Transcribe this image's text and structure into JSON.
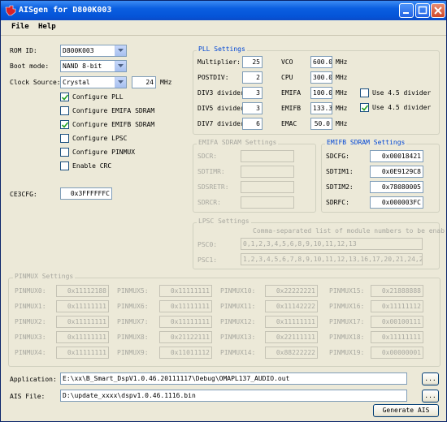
{
  "window": {
    "title": "AISgen for D800K003"
  },
  "menu": [
    "File",
    "Help"
  ],
  "left": {
    "rom_id_label": "ROM ID:",
    "rom_id_value": "D800K003",
    "boot_mode_label": "Boot mode:",
    "boot_mode_value": "NAND 8-bit",
    "clock_source_label": "Clock Source:",
    "clock_source_value": "Crystal",
    "clock_freq": "24",
    "clock_unit": "MHz",
    "checkboxes": [
      {
        "label": "Configure PLL",
        "checked": true
      },
      {
        "label": "Configure EMIFA SDRAM",
        "checked": false
      },
      {
        "label": "Configure EMIFB SDRAM",
        "checked": true
      },
      {
        "label": "Configure LPSC",
        "checked": false
      },
      {
        "label": "Configure PINMUX",
        "checked": false
      },
      {
        "label": "Enable CRC",
        "checked": false
      }
    ],
    "ce3cfg_label": "CE3CFG:",
    "ce3cfg_value": "0x3FFFFFFC"
  },
  "pll": {
    "title": "PLL Settings",
    "rows": [
      {
        "label": "Multiplier:",
        "value": "25",
        "clk": "VCO",
        "clk_value": "600.0",
        "unit": "MHz"
      },
      {
        "label": "POSTDIV:",
        "value": "2",
        "clk": "CPU",
        "clk_value": "300.0",
        "unit": "MHz"
      },
      {
        "label": "DIV3 divider:",
        "value": "3",
        "clk": "EMIFA",
        "clk_value": "100.0",
        "unit": "MHz"
      },
      {
        "label": "DIV5 divider:",
        "value": "3",
        "clk": "EMIFB",
        "clk_value": "133.3",
        "unit": "MHz"
      },
      {
        "label": "DIV7 divider:",
        "value": "6",
        "clk": "EMAC",
        "clk_value": "50.0",
        "unit": "MHz"
      }
    ],
    "use45_a": {
      "label": "Use 4.5 divider",
      "checked": false
    },
    "use45_b": {
      "label": "Use 4.5 divider",
      "checked": true
    }
  },
  "emifa": {
    "title": "EMIFA SDRAM Settings",
    "fields": [
      {
        "label": "SDCR:",
        "value": ""
      },
      {
        "label": "SDTIMR:",
        "value": ""
      },
      {
        "label": "SDSRETR:",
        "value": ""
      },
      {
        "label": "SDRCR:",
        "value": ""
      }
    ]
  },
  "emifb": {
    "title": "EMIFB SDRAM Settings",
    "fields": [
      {
        "label": "SDCFG:",
        "value": "0x00018421"
      },
      {
        "label": "SDTIM1:",
        "value": "0x0E9129C8"
      },
      {
        "label": "SDTIM2:",
        "value": "0x78080005"
      },
      {
        "label": "SDRFC:",
        "value": "0x000003FC"
      }
    ]
  },
  "lpsc": {
    "title": "LPSC Settings",
    "hint": "Comma-separated list of module numbers to be enab",
    "psc0_label": "PSC0:",
    "psc0_value": "0,1,2,3,4,5,6,8,9,10,11,12,13",
    "psc1_label": "PSC1:",
    "psc1_value": "1,2,3,4,5,6,7,8,9,10,11,12,13,16,17,20,21,24,25"
  },
  "pinmux": {
    "title": "PINMUX Settings",
    "cols": [
      [
        {
          "label": "PINMUX0:",
          "value": "0x11112188"
        },
        {
          "label": "PINMUX1:",
          "value": "0x11111111"
        },
        {
          "label": "PINMUX2:",
          "value": "0x11111111"
        },
        {
          "label": "PINMUX3:",
          "value": "0x11111111"
        },
        {
          "label": "PINMUX4:",
          "value": "0x11111111"
        }
      ],
      [
        {
          "label": "PINMUX5:",
          "value": "0x11111111"
        },
        {
          "label": "PINMUX6:",
          "value": "0x11111111"
        },
        {
          "label": "PINMUX7:",
          "value": "0x11111111"
        },
        {
          "label": "PINMUX8:",
          "value": "0x21122111"
        },
        {
          "label": "PINMUX9:",
          "value": "0x11011112"
        }
      ],
      [
        {
          "label": "PINMUX10:",
          "value": "0x22222221"
        },
        {
          "label": "PINMUX11:",
          "value": "0x11142222"
        },
        {
          "label": "PINMUX12:",
          "value": "0x11111111"
        },
        {
          "label": "PINMUX13:",
          "value": "0x22111111"
        },
        {
          "label": "PINMUX14:",
          "value": "0x88222222"
        }
      ],
      [
        {
          "label": "PINMUX15:",
          "value": "0x21888888"
        },
        {
          "label": "PINMUX16:",
          "value": "0x11111112"
        },
        {
          "label": "PINMUX17:",
          "value": "0x00100111"
        },
        {
          "label": "PINMUX18:",
          "value": "0x11111111"
        },
        {
          "label": "PINMUX19:",
          "value": "0x00000001"
        }
      ]
    ]
  },
  "files": {
    "application_label": "Application:",
    "application_value": "E:\\xx\\B_Smart_DspV1.0.46.20111117\\Debug\\OMAPL137_AUDIO.out",
    "ais_label": "AIS File:",
    "ais_value": "D:\\update_xxxx\\dspv1.0.46.1116.bin",
    "browse_label": "...",
    "generate_label": "Generate AIS"
  }
}
